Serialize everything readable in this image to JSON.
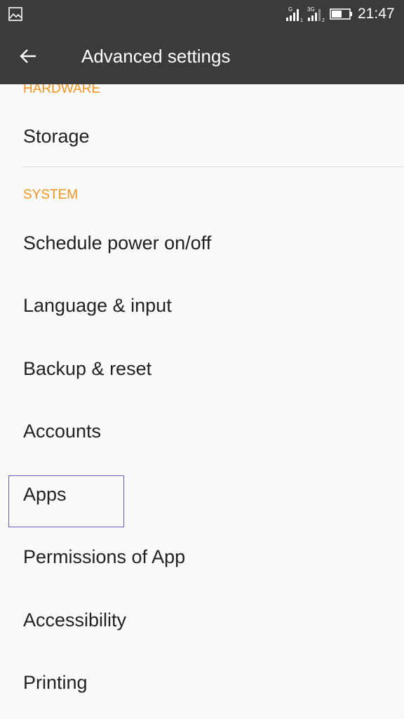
{
  "status_bar": {
    "time": "21:47",
    "sim1_network": "G",
    "sim1_slot": "1",
    "sim2_network": "3G",
    "sim2_slot": "2",
    "left_icon": "gallery-icon"
  },
  "app_bar": {
    "back_icon": "arrow-left-icon",
    "title": "Advanced settings"
  },
  "sections": {
    "hardware": {
      "header": "HARDWARE",
      "items": [
        "Storage"
      ]
    },
    "system": {
      "header": "SYSTEM",
      "items": [
        "Schedule power on/off",
        "Language & input",
        "Backup & reset",
        "Accounts",
        "Apps",
        "Permissions of App",
        "Accessibility",
        "Printing"
      ]
    }
  },
  "colors": {
    "bar_background": "#3b3b3b",
    "section_header": "#f7941d",
    "item_text": "#212121",
    "page_background": "#fafafa"
  }
}
